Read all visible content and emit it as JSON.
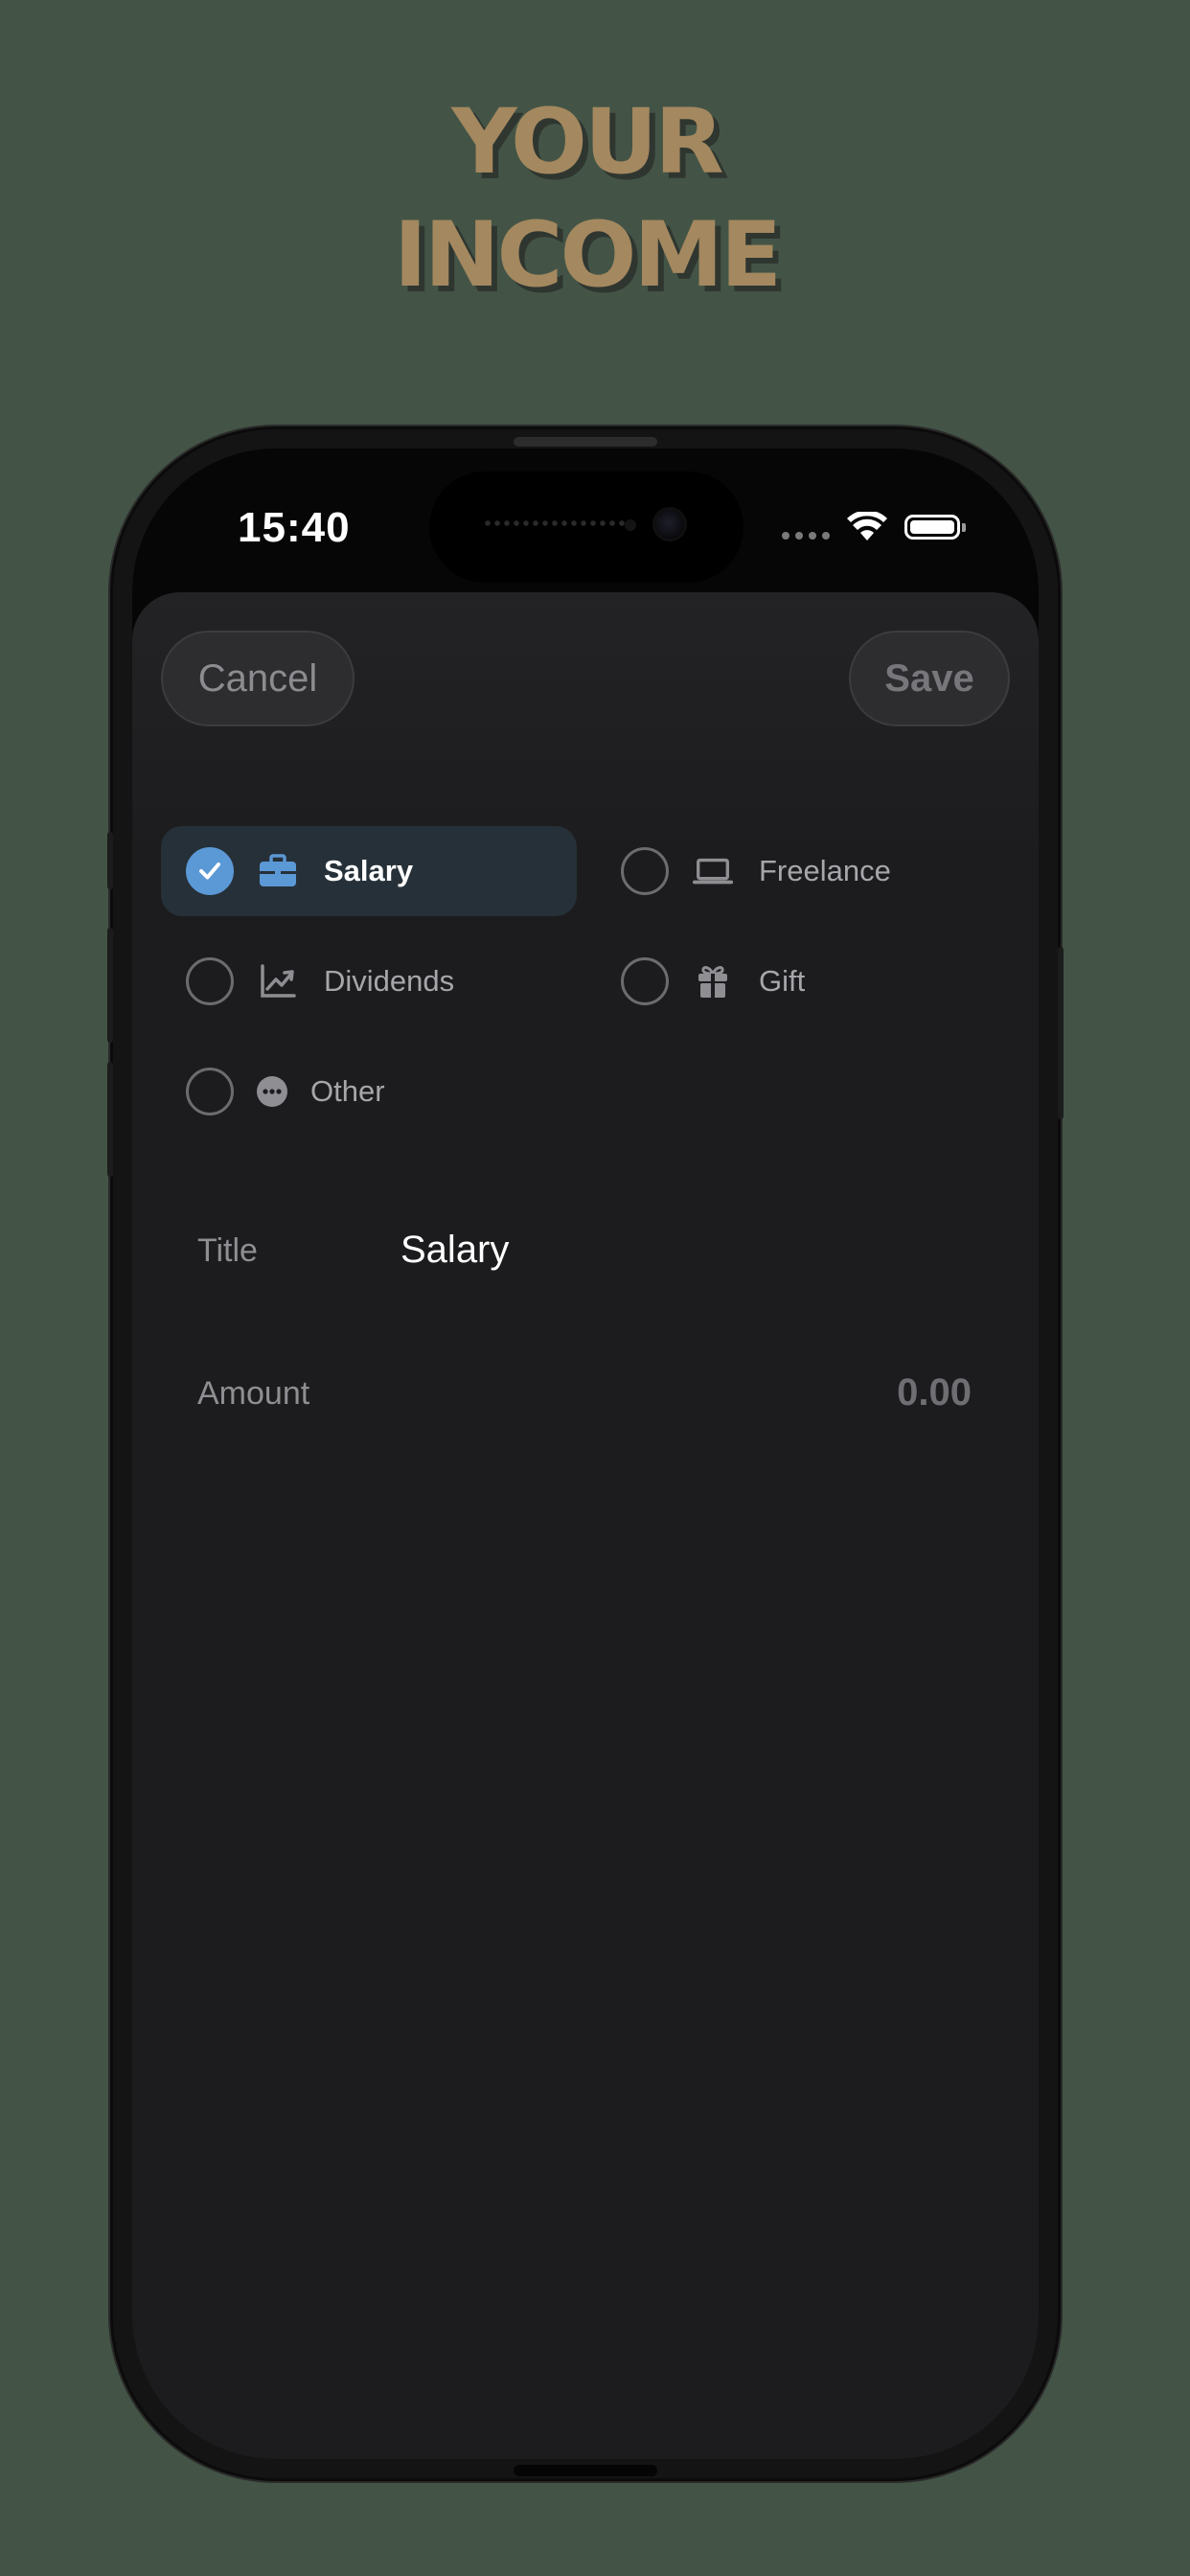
{
  "headline": {
    "line1": "YOUR",
    "line2": "INCOME"
  },
  "status_bar": {
    "time": "15:40"
  },
  "toolbar": {
    "cancel_label": "Cancel",
    "save_label": "Save"
  },
  "categories": [
    {
      "label": "Salary",
      "icon": "briefcase-icon",
      "selected": true
    },
    {
      "label": "Freelance",
      "icon": "laptop-icon",
      "selected": false
    },
    {
      "label": "Dividends",
      "icon": "chart-line-icon",
      "selected": false
    },
    {
      "label": "Gift",
      "icon": "gift-icon",
      "selected": false
    },
    {
      "label": "Other",
      "icon": "ellipsis-circle-icon",
      "selected": false
    }
  ],
  "form": {
    "title_label": "Title",
    "title_value": "Salary",
    "amount_label": "Amount",
    "amount_placeholder": "0.00"
  },
  "colors": {
    "background": "#435446",
    "headline": "#a4885f",
    "accent": "#5b98d6",
    "sheet": "#1c1c1e"
  }
}
